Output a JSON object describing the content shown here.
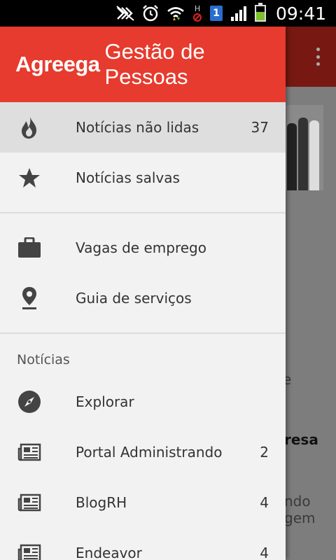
{
  "status_bar": {
    "time": "09:41",
    "sim_slot": "1",
    "network_type": "H",
    "battery_level_percent": 60,
    "icons": [
      "nfc-icon",
      "alarm-icon",
      "wifi-icon",
      "signal-icon",
      "battery-icon"
    ]
  },
  "drawer": {
    "brand_name": "Agreega",
    "brand_tagline": "Gestão de Pessoas",
    "primary_items": [
      {
        "icon": "fire-icon",
        "label": "Notícias não lidas",
        "count": "37",
        "active": true
      },
      {
        "icon": "star-icon",
        "label": "Notícias salvas",
        "count": "",
        "active": false
      }
    ],
    "secondary_items": [
      {
        "icon": "briefcase-icon",
        "label": "Vagas de emprego",
        "count": ""
      },
      {
        "icon": "location-pin-icon",
        "label": "Guia de serviços",
        "count": ""
      }
    ],
    "section_title": "Notícias",
    "feed_items": [
      {
        "icon": "compass-icon",
        "label": "Explorar",
        "count": ""
      },
      {
        "icon": "newspaper-icon",
        "label": "Portal Administrando",
        "count": "2"
      },
      {
        "icon": "newspaper-icon",
        "label": "BlogRH",
        "count": "4"
      },
      {
        "icon": "newspaper-icon",
        "label": "Endeavor",
        "count": "4"
      }
    ]
  },
  "background": {
    "text_fragments": [
      "e",
      "resa",
      "ndo",
      "gem"
    ]
  },
  "colors": {
    "header_red": "#e63b2e",
    "drawer_bg": "#f2f2f2",
    "active_row": "#dedede",
    "icon_gray": "#444444"
  }
}
